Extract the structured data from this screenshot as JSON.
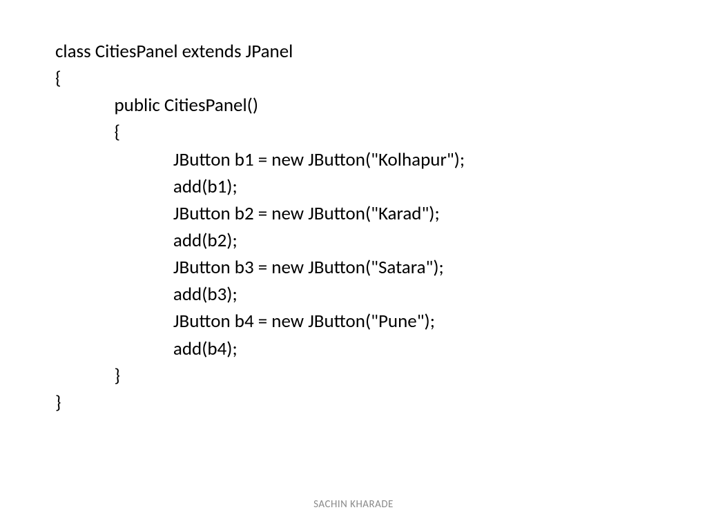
{
  "code": {
    "line1": "class CitiesPanel extends JPanel",
    "line2": "{",
    "line3": "              public CitiesPanel()",
    "line4": "              {",
    "line5": "                            JButton b1 = new JButton(\"Kolhapur\");",
    "line6": "                            add(b1);",
    "line7": "                            JButton b2 = new JButton(\"Karad\");",
    "line8": "                            add(b2);",
    "line9": "                            JButton b3 = new JButton(\"Satara\");",
    "line10": "                            add(b3);",
    "line11": "                            JButton b4 = new JButton(\"Pune\");",
    "line12": "                            add(b4);",
    "line13": "              }",
    "line14": "}"
  },
  "footer": "SACHIN KHARADE"
}
